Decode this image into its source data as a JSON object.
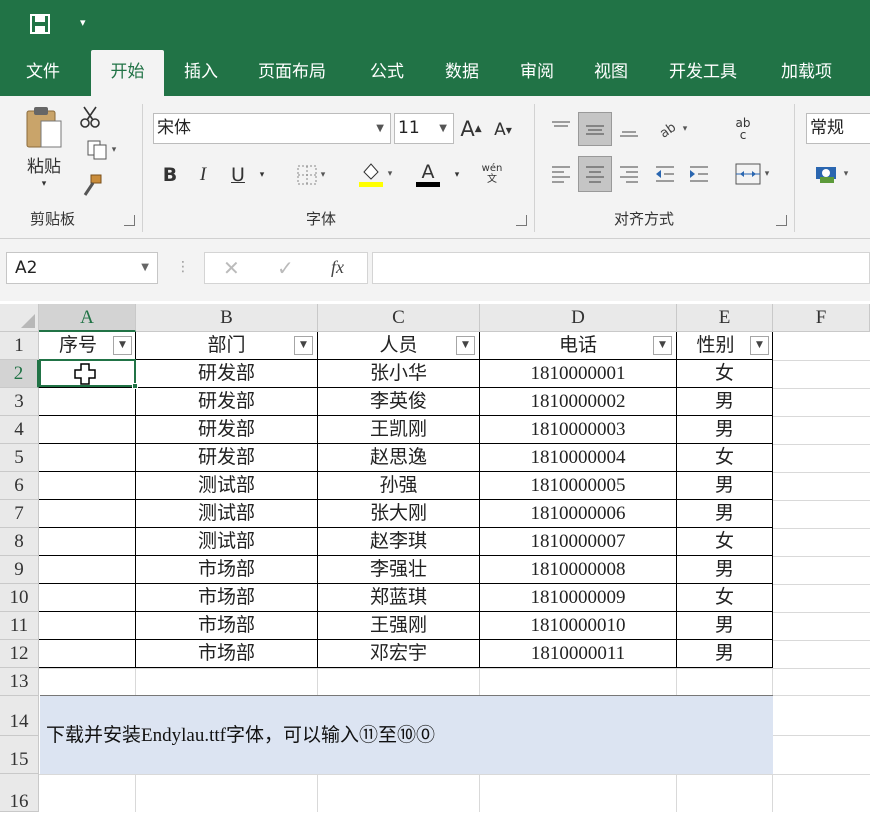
{
  "qat": {
    "save_icon": "save-icon",
    "dropdown": "▾"
  },
  "tabs": [
    "文件",
    "开始",
    "插入",
    "页面布局",
    "公式",
    "数据",
    "审阅",
    "视图",
    "开发工具",
    "加载项"
  ],
  "ribbon": {
    "clipboard": {
      "paste_label": "粘贴",
      "group_label": "剪贴板",
      "cut_icon": "scissors-icon",
      "copy_icon": "copy-icon",
      "format_painter_icon": "format-painter-icon"
    },
    "font": {
      "name": "宋体",
      "size": "11",
      "group_label": "字体",
      "grow": "A",
      "shrink": "A",
      "bold": "B",
      "italic": "I",
      "underline": "U",
      "font_color": "A",
      "phonetic": "wén\n文"
    },
    "alignment": {
      "group_label": "对齐方式",
      "wrap": "ab\nc"
    },
    "number": {
      "format": "常规"
    }
  },
  "formula_bar": {
    "name_box": "A2",
    "cancel": "✕",
    "enter": "✓",
    "fx": "fx",
    "formula": ""
  },
  "columns": [
    "A",
    "B",
    "C",
    "D",
    "E",
    "F"
  ],
  "rows": [
    "1",
    "2",
    "3",
    "4",
    "5",
    "6",
    "7",
    "8",
    "9",
    "10",
    "11",
    "12",
    "13",
    "14",
    "15",
    "16"
  ],
  "table": {
    "headers": [
      "序号",
      "部门",
      "人员",
      "电话",
      "性别"
    ],
    "rows": [
      [
        "",
        "研发部",
        "张小华",
        "1810000001",
        "女"
      ],
      [
        "",
        "研发部",
        "李英俊",
        "1810000002",
        "男"
      ],
      [
        "",
        "研发部",
        "王凯刚",
        "1810000003",
        "男"
      ],
      [
        "",
        "研发部",
        "赵思逸",
        "1810000004",
        "女"
      ],
      [
        "",
        "测试部",
        "孙强",
        "1810000005",
        "男"
      ],
      [
        "",
        "测试部",
        "张大刚",
        "1810000006",
        "男"
      ],
      [
        "",
        "测试部",
        "赵李琪",
        "1810000007",
        "女"
      ],
      [
        "",
        "市场部",
        "李强壮",
        "1810000008",
        "男"
      ],
      [
        "",
        "市场部",
        "郑蓝琪",
        "1810000009",
        "女"
      ],
      [
        "",
        "市场部",
        "王强刚",
        "1810000010",
        "男"
      ],
      [
        "",
        "市场部",
        "邓宏宇",
        "1810000011",
        "男"
      ]
    ]
  },
  "note": "下载并安装Endylau.ttf字体，可以输入⑪至⑩⓪",
  "colors": {
    "brand": "#217346",
    "note_bg": "#dce4f2"
  }
}
